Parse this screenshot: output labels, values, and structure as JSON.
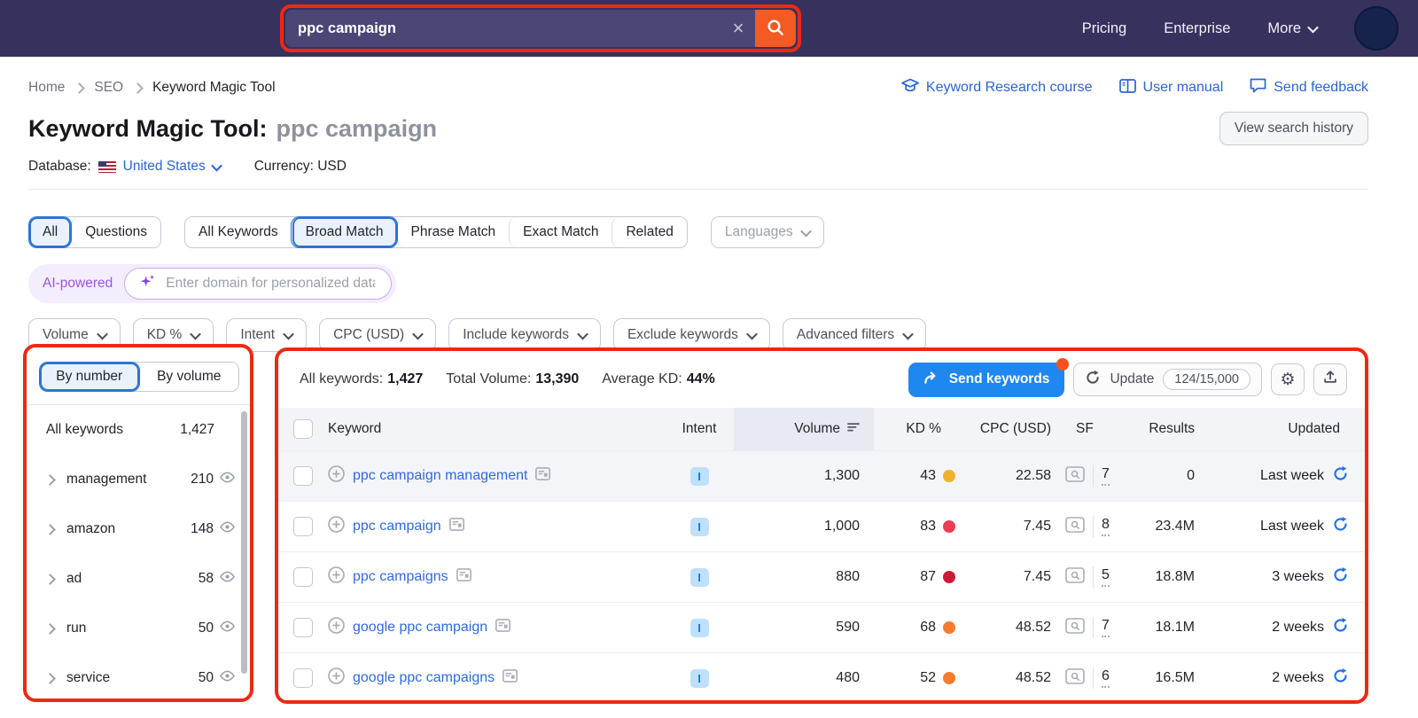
{
  "header": {
    "search": {
      "value": "ppc campaign"
    },
    "nav": [
      {
        "label": "Pricing"
      },
      {
        "label": "Enterprise"
      },
      {
        "label": "More"
      }
    ]
  },
  "breadcrumb": {
    "items": [
      "Home",
      "SEO",
      "Keyword Magic Tool"
    ]
  },
  "help_links": [
    {
      "label": "Keyword Research course"
    },
    {
      "label": "User manual"
    },
    {
      "label": "Send feedback"
    }
  ],
  "page": {
    "title": "Keyword Magic Tool:",
    "query": "ppc campaign",
    "view_history": "View search history",
    "database_label": "Database:",
    "database_value": "United States",
    "currency_label": "Currency:",
    "currency_value": "USD"
  },
  "tabs": {
    "group1": [
      "All",
      "Questions"
    ],
    "group1_active": "All",
    "group2": [
      "All Keywords",
      "Broad Match",
      "Phrase Match",
      "Exact Match",
      "Related"
    ],
    "group2_active": "Broad Match",
    "languages": "Languages"
  },
  "ai_bar": {
    "badge": "AI-powered",
    "placeholder": "Enter domain for personalized data"
  },
  "filters": [
    "Volume",
    "KD %",
    "Intent",
    "CPC (USD)",
    "Include keywords",
    "Exclude keywords",
    "Advanced filters"
  ],
  "sidebar": {
    "toggle": [
      "By number",
      "By volume"
    ],
    "toggle_active": "By number",
    "all_row": {
      "label": "All keywords",
      "count": "1,427"
    },
    "items": [
      {
        "label": "management",
        "count": "210"
      },
      {
        "label": "amazon",
        "count": "148"
      },
      {
        "label": "ad",
        "count": "58"
      },
      {
        "label": "run",
        "count": "50"
      },
      {
        "label": "service",
        "count": "50"
      }
    ]
  },
  "summary": {
    "all_keywords_label": "All keywords:",
    "all_keywords": "1,427",
    "total_volume_label": "Total Volume:",
    "total_volume": "13,390",
    "avg_kd_label": "Average KD:",
    "avg_kd": "44%"
  },
  "actions": {
    "send": "Send keywords",
    "update": "Update",
    "quota": "124/15,000"
  },
  "table": {
    "columns": [
      "Keyword",
      "Intent",
      "Volume",
      "KD %",
      "CPC (USD)",
      "SF",
      "Results",
      "Updated"
    ],
    "rows": [
      {
        "keyword": "ppc campaign management",
        "intent": "I",
        "volume": "1,300",
        "kd": "43",
        "kd_color": "#f3b02c",
        "cpc": "22.58",
        "sf": "7",
        "results": "0",
        "updated": "Last week"
      },
      {
        "keyword": "ppc campaign",
        "intent": "I",
        "volume": "1,000",
        "kd": "83",
        "kd_color": "#ee3b54",
        "cpc": "7.45",
        "sf": "8",
        "results": "23.4M",
        "updated": "Last week"
      },
      {
        "keyword": "ppc campaigns",
        "intent": "I",
        "volume": "880",
        "kd": "87",
        "kd_color": "#cd1a38",
        "cpc": "7.45",
        "sf": "5",
        "results": "18.8M",
        "updated": "3 weeks"
      },
      {
        "keyword": "google ppc campaign",
        "intent": "I",
        "volume": "590",
        "kd": "68",
        "kd_color": "#f77b2f",
        "cpc": "48.52",
        "sf": "7",
        "results": "18.1M",
        "updated": "2 weeks"
      },
      {
        "keyword": "google ppc campaigns",
        "intent": "I",
        "volume": "480",
        "kd": "52",
        "kd_color": "#f77b2f",
        "cpc": "48.52",
        "sf": "6",
        "results": "16.5M",
        "updated": "2 weeks"
      }
    ]
  },
  "icons": {
    "gear_glyph": "⚙",
    "clear_glyph": "×"
  },
  "colors": {
    "annotation_red": "#ea2a12",
    "header_bg": "#37315e",
    "search_button_orange": "#f55a22",
    "link_blue": "#2b64d6",
    "keyword_link_blue": "#2f6bdb",
    "send_button_blue": "#1f87f0",
    "intent_badge_bg": "#bfe0fa",
    "intent_badge_text": "#1878d2",
    "notification_dot_orange": "#f4511e"
  }
}
